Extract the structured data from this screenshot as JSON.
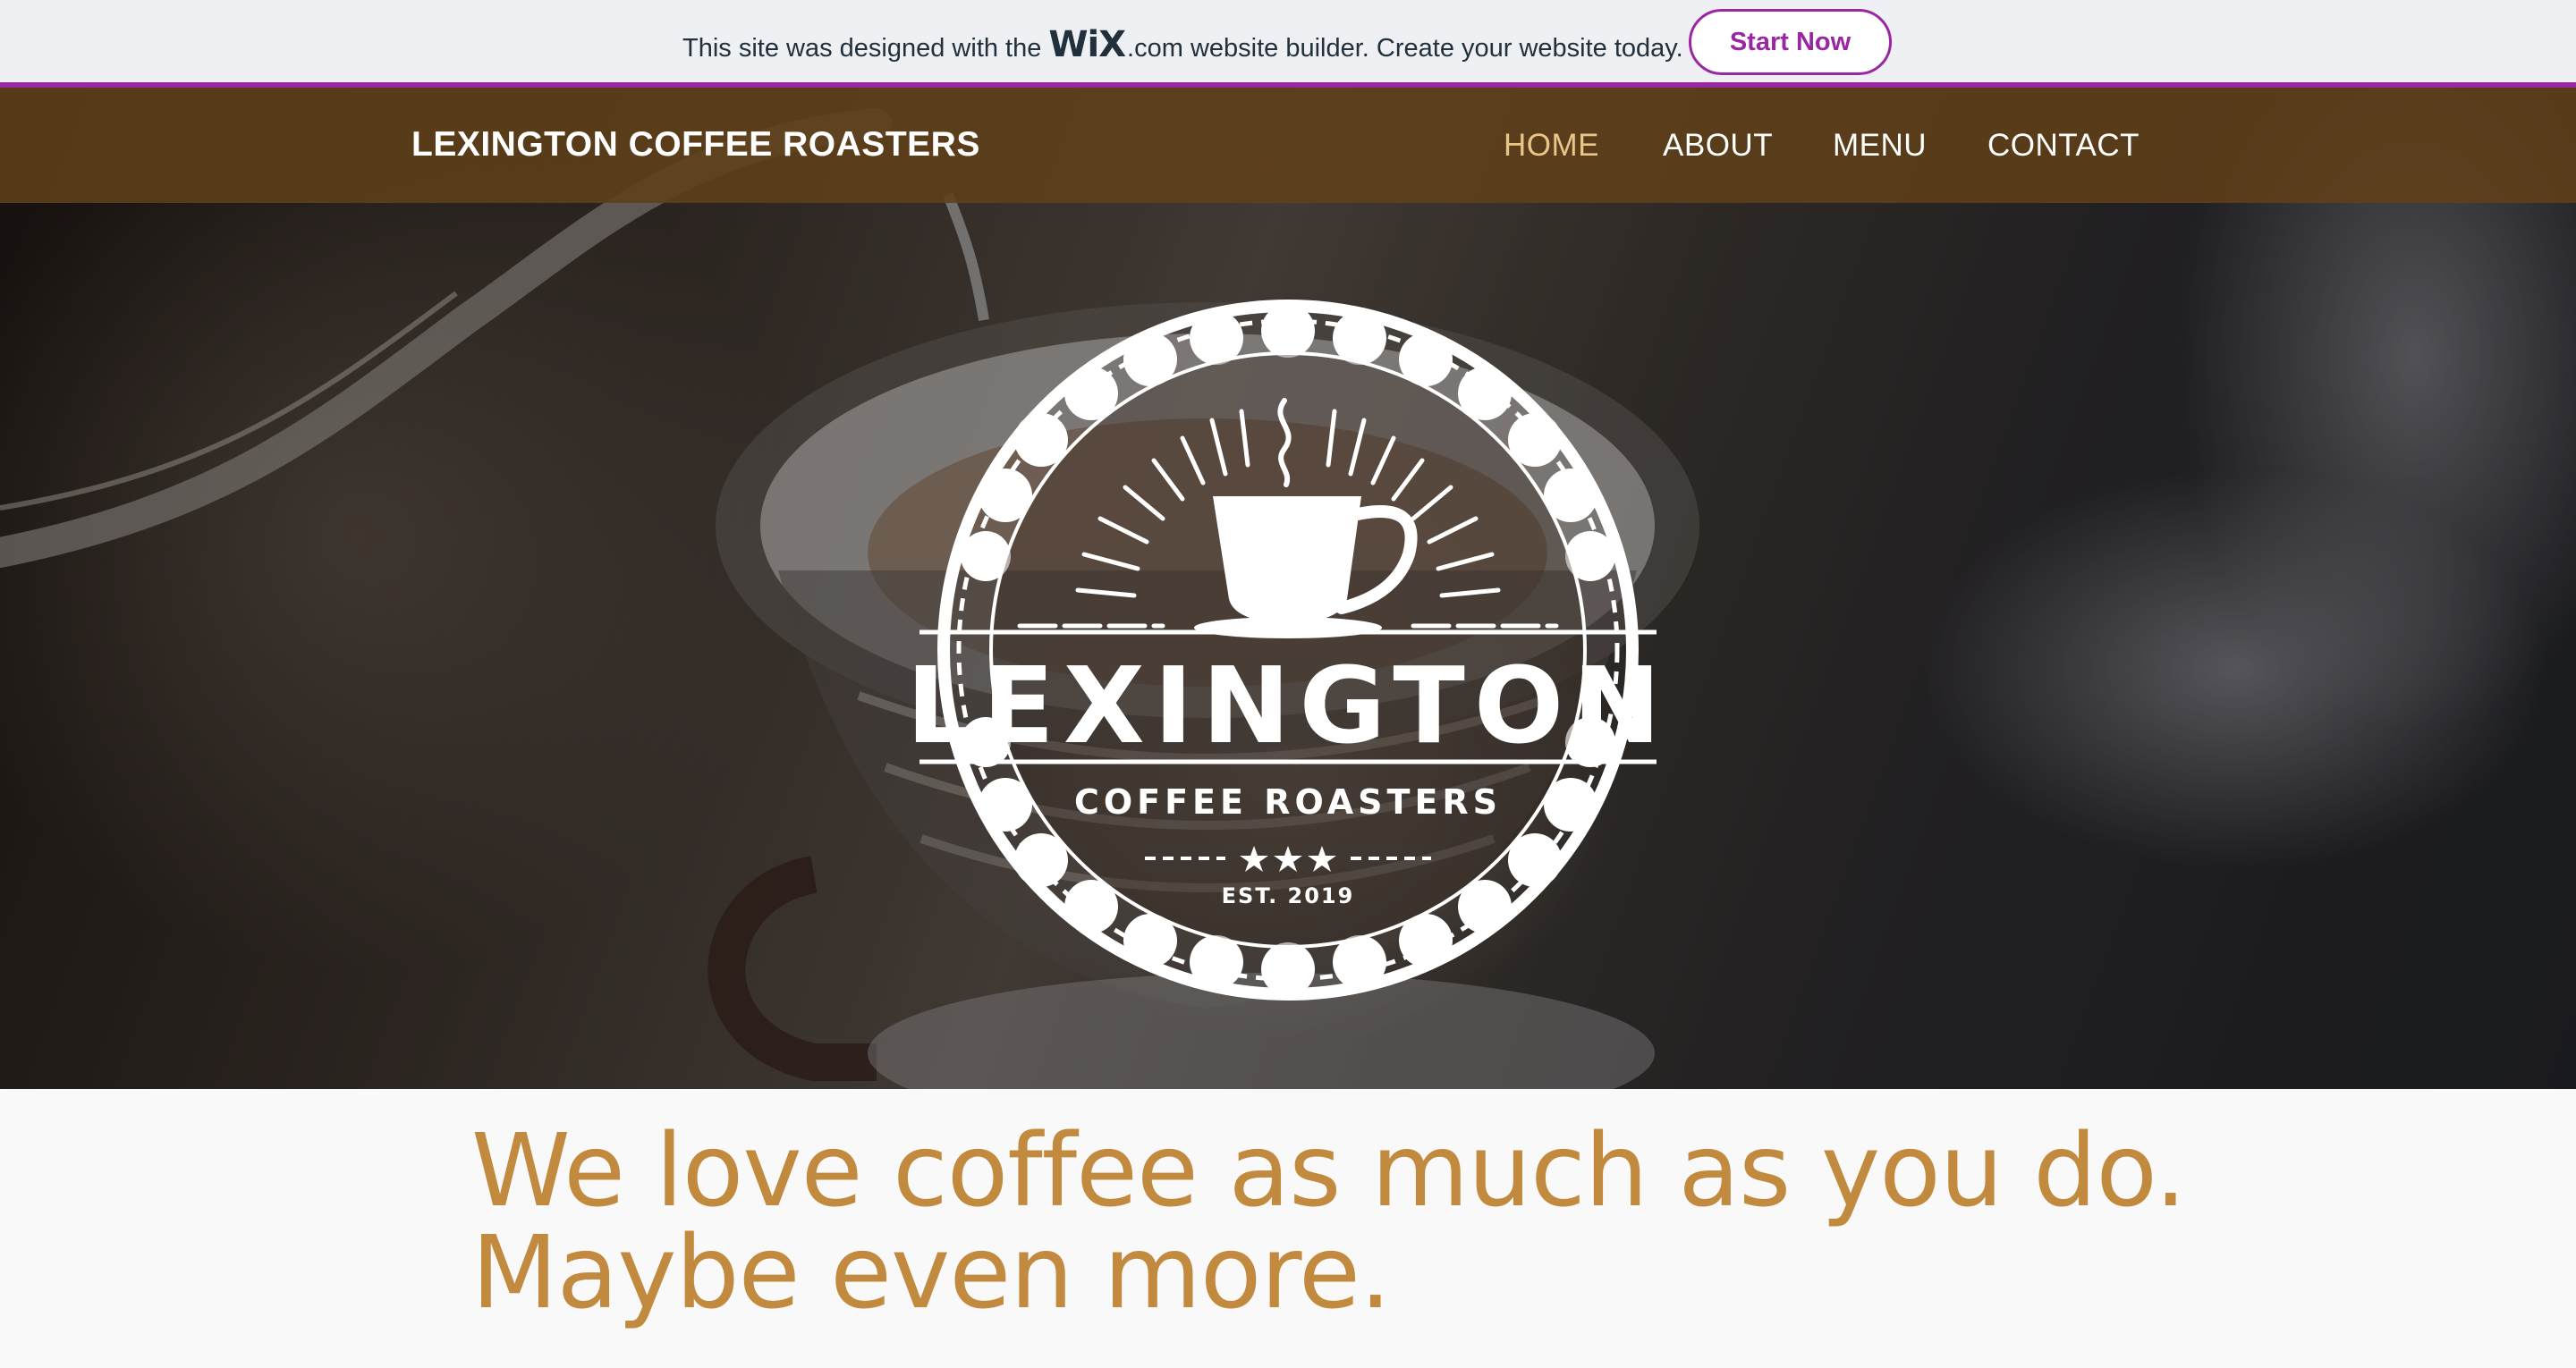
{
  "wix_banner": {
    "text_before": "This site was designed with the",
    "logo_text": "WiX",
    "text_after": ".com website builder. Create your website today.",
    "button_label": "Start Now",
    "accent_color": "#9a27a2"
  },
  "header": {
    "brand": "LEXINGTON COFFEE ROASTERS",
    "nav": [
      {
        "label": "HOME",
        "active": true
      },
      {
        "label": "ABOUT",
        "active": false
      },
      {
        "label": "MENU",
        "active": false
      },
      {
        "label": "CONTACT",
        "active": false
      }
    ],
    "bar_color": "#604019",
    "active_color": "#e8c589"
  },
  "hero": {
    "logo": {
      "name": "LEXINGTON",
      "subtitle": "COFFEE ROASTERS",
      "established": "EST. 2019",
      "icon": "coffee-cup-icon"
    }
  },
  "intro": {
    "line1": "We love coffee as much as you do.",
    "line2": "Maybe even more.",
    "color": "#c28a3f"
  }
}
